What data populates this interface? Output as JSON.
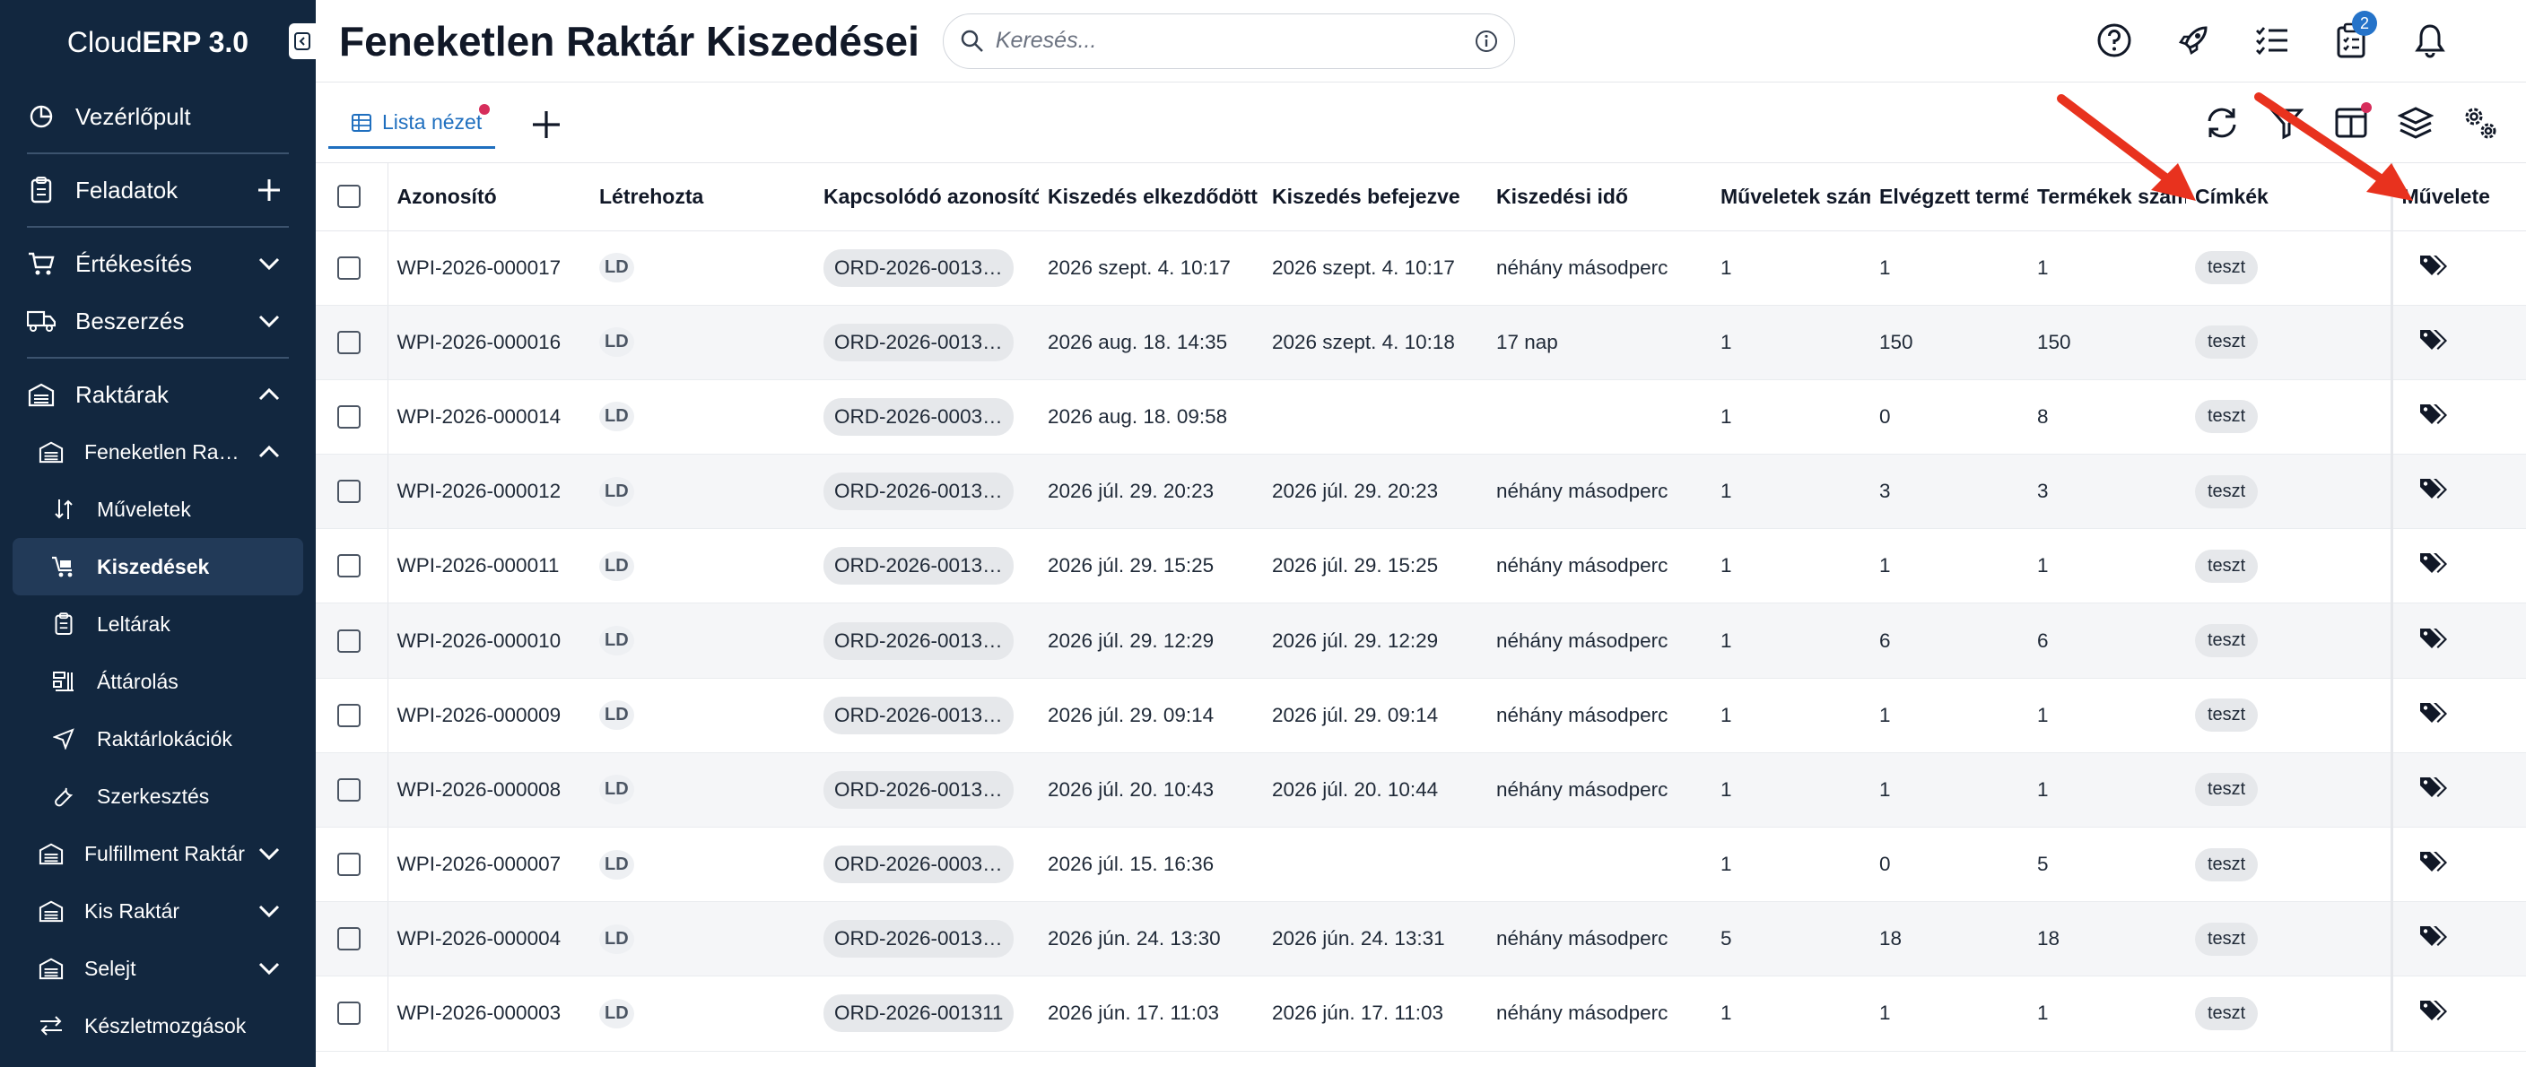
{
  "app": {
    "brand_light": "Cloud",
    "brand_bold": "ERP 3.0"
  },
  "sidebar": {
    "items": [
      {
        "label": "Vezérlőpult",
        "icon": "dashboard-icon"
      },
      {
        "label": "Feladatok",
        "icon": "clipboard-icon",
        "trail": "plus-icon"
      },
      {
        "label": "Értékesítés",
        "icon": "cart-icon",
        "trail": "chevron-down-icon"
      },
      {
        "label": "Beszerzés",
        "icon": "truck-icon",
        "trail": "chevron-down-icon"
      },
      {
        "label": "Raktárak",
        "icon": "warehouse-icon",
        "trail": "chevron-up-icon"
      }
    ],
    "warehouses": [
      {
        "label": "Feneketlen Ra…",
        "expanded": true
      },
      {
        "label": "Fulfillment Raktár"
      },
      {
        "label": "Kis Raktár"
      },
      {
        "label": "Selejt"
      }
    ],
    "warehouse_sub": [
      {
        "label": "Műveletek",
        "icon": "arrows-updown-icon"
      },
      {
        "label": "Kiszedések",
        "icon": "picking-cart-icon",
        "active": true
      },
      {
        "label": "Leltárak",
        "icon": "clipboard-icon"
      },
      {
        "label": "Áttárolás",
        "icon": "shelf-icon"
      },
      {
        "label": "Raktárlokációk",
        "icon": "location-arrow-icon"
      },
      {
        "label": "Szerkesztés",
        "icon": "wrench-icon"
      }
    ],
    "bottom_item": {
      "label": "Készletmozgások"
    }
  },
  "header": {
    "title": "Feneketlen Raktár Kiszedései",
    "search_placeholder": "Keresés...",
    "notification_badge": "2"
  },
  "tabs": {
    "list_view": "Lista nézet"
  },
  "table": {
    "columns": [
      "Azonosító",
      "Létrehozta",
      "Kapcsolódó azonosító",
      "Kiszedés elkezdődött",
      "Kiszedés befejezve",
      "Kiszedési idő",
      "Műveletek száma",
      "Elvégzett termékek",
      "Termékek száma",
      "Címkék",
      "Művelete"
    ],
    "rows": [
      {
        "id": "WPI-2026-000017",
        "by": "LD",
        "ref": "ORD-2026-0013…",
        "start": "2026 szept. 4. 10:17",
        "end": "2026 szept. 4. 10:17",
        "dur": "néhány másodperc",
        "ops": "1",
        "done": "1",
        "prod": "1",
        "tag": "teszt"
      },
      {
        "id": "WPI-2026-000016",
        "by": "LD",
        "ref": "ORD-2026-0013…",
        "start": "2026 aug. 18. 14:35",
        "end": "2026 szept. 4. 10:18",
        "dur": "17 nap",
        "ops": "1",
        "done": "150",
        "prod": "150",
        "tag": "teszt"
      },
      {
        "id": "WPI-2026-000014",
        "by": "LD",
        "ref": "ORD-2026-0003…",
        "start": "2026 aug. 18. 09:58",
        "end": "",
        "dur": "",
        "ops": "1",
        "done": "0",
        "prod": "8",
        "tag": "teszt"
      },
      {
        "id": "WPI-2026-000012",
        "by": "LD",
        "ref": "ORD-2026-0013…",
        "start": "2026 júl. 29. 20:23",
        "end": "2026 júl. 29. 20:23",
        "dur": "néhány másodperc",
        "ops": "1",
        "done": "3",
        "prod": "3",
        "tag": "teszt"
      },
      {
        "id": "WPI-2026-000011",
        "by": "LD",
        "ref": "ORD-2026-0013…",
        "start": "2026 júl. 29. 15:25",
        "end": "2026 júl. 29. 15:25",
        "dur": "néhány másodperc",
        "ops": "1",
        "done": "1",
        "prod": "1",
        "tag": "teszt"
      },
      {
        "id": "WPI-2026-000010",
        "by": "LD",
        "ref": "ORD-2026-0013…",
        "start": "2026 júl. 29. 12:29",
        "end": "2026 júl. 29. 12:29",
        "dur": "néhány másodperc",
        "ops": "1",
        "done": "6",
        "prod": "6",
        "tag": "teszt"
      },
      {
        "id": "WPI-2026-000009",
        "by": "LD",
        "ref": "ORD-2026-0013…",
        "start": "2026 júl. 29. 09:14",
        "end": "2026 júl. 29. 09:14",
        "dur": "néhány másodperc",
        "ops": "1",
        "done": "1",
        "prod": "1",
        "tag": "teszt"
      },
      {
        "id": "WPI-2026-000008",
        "by": "LD",
        "ref": "ORD-2026-0013…",
        "start": "2026 júl. 20. 10:43",
        "end": "2026 júl. 20. 10:44",
        "dur": "néhány másodperc",
        "ops": "1",
        "done": "1",
        "prod": "1",
        "tag": "teszt"
      },
      {
        "id": "WPI-2026-000007",
        "by": "LD",
        "ref": "ORD-2026-0003…",
        "start": "2026 júl. 15. 16:36",
        "end": "",
        "dur": "",
        "ops": "1",
        "done": "0",
        "prod": "5",
        "tag": "teszt"
      },
      {
        "id": "WPI-2026-000004",
        "by": "LD",
        "ref": "ORD-2026-0013…",
        "start": "2026 jún. 24. 13:30",
        "end": "2026 jún. 24. 13:31",
        "dur": "néhány másodperc",
        "ops": "5",
        "done": "18",
        "prod": "18",
        "tag": "teszt"
      },
      {
        "id": "WPI-2026-000003",
        "by": "LD",
        "ref": "ORD-2026-001311",
        "start": "2026 jún. 17. 11:03",
        "end": "2026 jún. 17. 11:03",
        "dur": "néhány másodperc",
        "ops": "1",
        "done": "1",
        "prod": "1",
        "tag": "teszt"
      }
    ]
  },
  "colors": {
    "sidebar_bg": "#12273f",
    "accent": "#1f6fbf",
    "badge": "#2573c9",
    "dot": "#d62d5b",
    "annotation_arrow": "#e8321e"
  }
}
